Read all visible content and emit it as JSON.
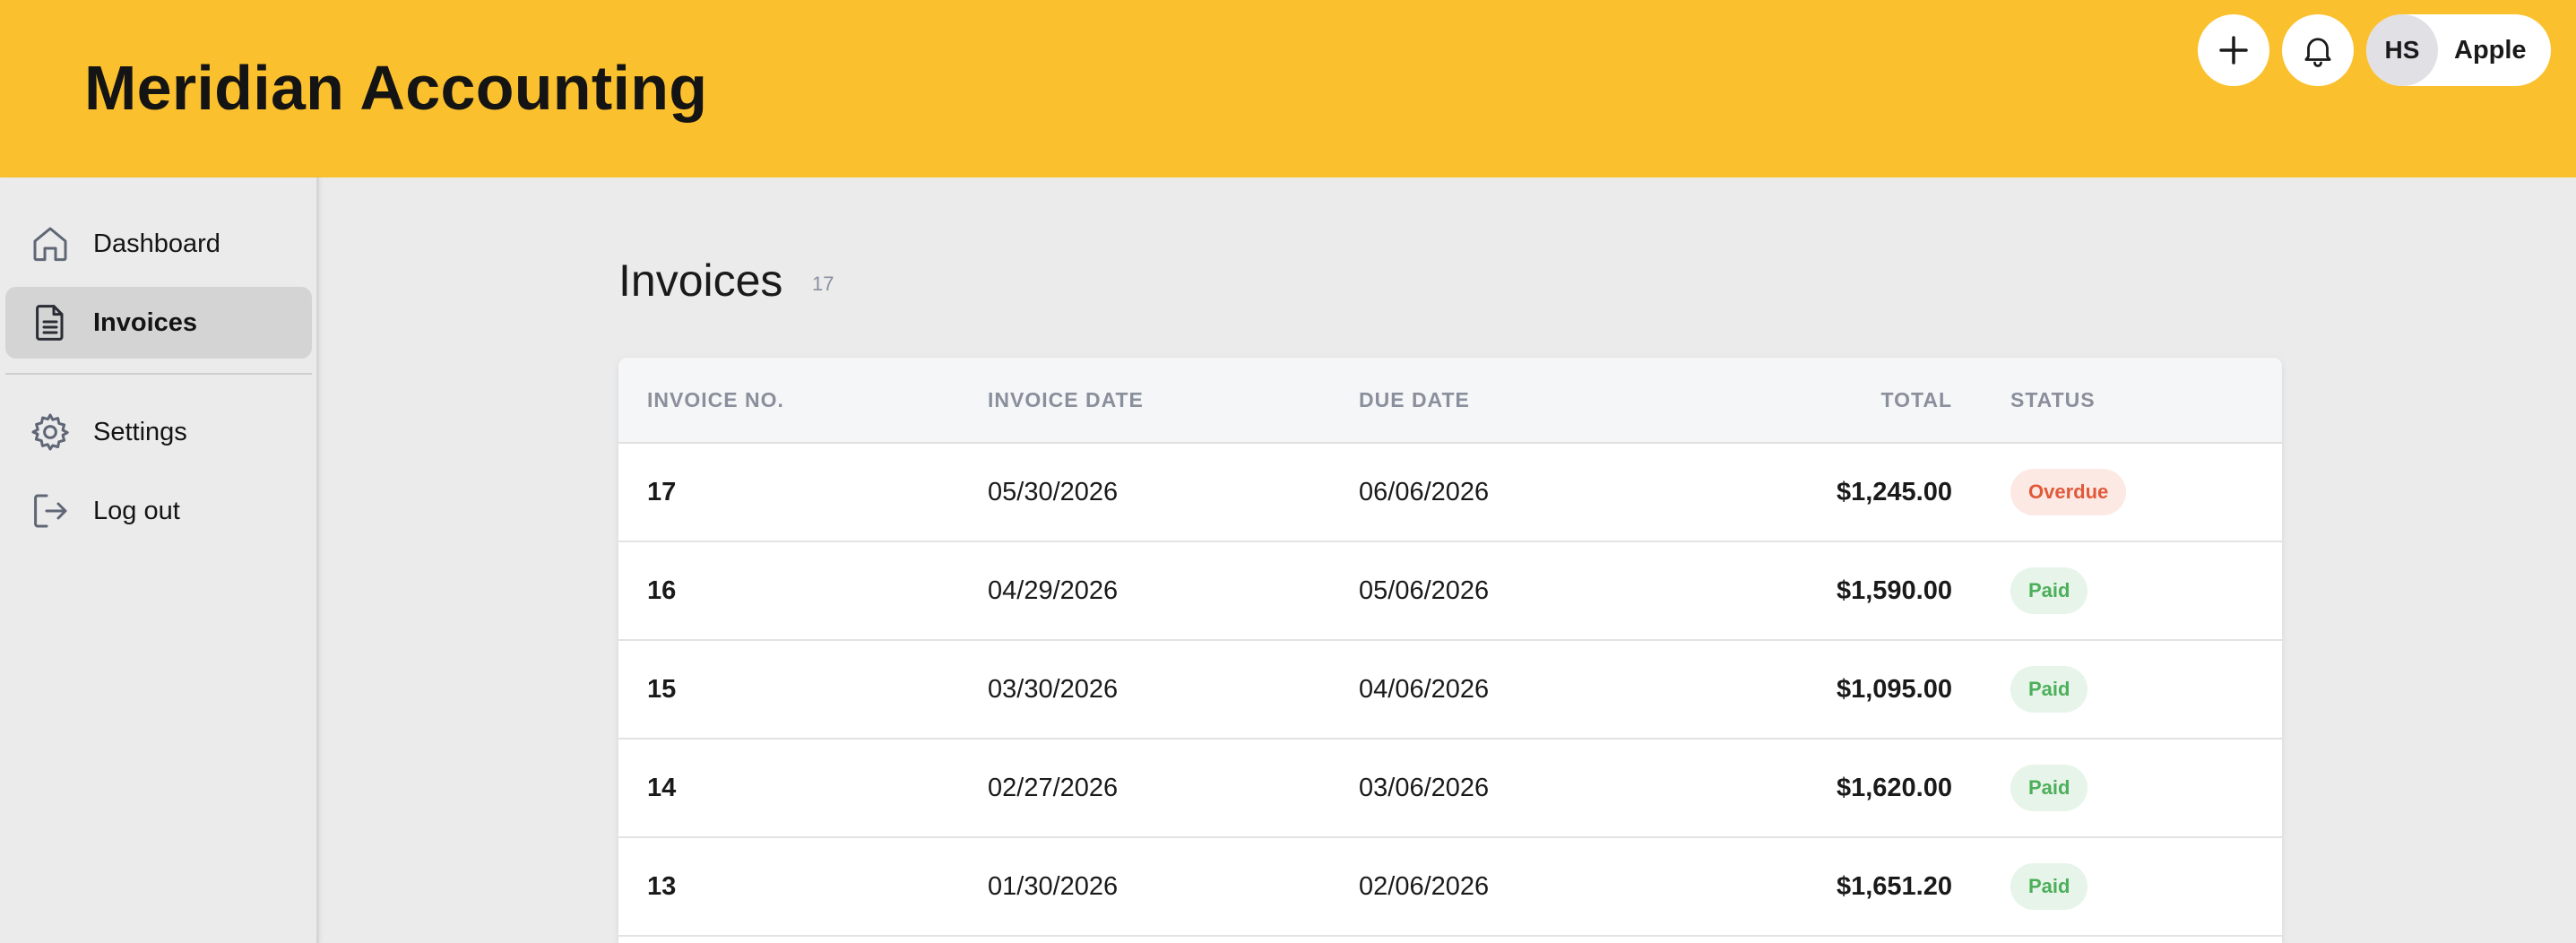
{
  "header": {
    "app_title": "Meridian Accounting",
    "user_initials": "HS",
    "user_name": "Apple"
  },
  "sidebar": {
    "items": [
      {
        "label": "Dashboard",
        "icon": "home-icon"
      },
      {
        "label": "Invoices",
        "icon": "document-icon",
        "active": true
      },
      {
        "label": "Settings",
        "icon": "gear-icon"
      },
      {
        "label": "Log out",
        "icon": "logout-icon"
      }
    ]
  },
  "main": {
    "title": "Invoices",
    "count": "17",
    "columns": [
      "INVOICE NO.",
      "INVOICE DATE",
      "DUE DATE",
      "TOTAL",
      "STATUS"
    ],
    "rows": [
      {
        "no": "17",
        "invoice_date": "05/30/2026",
        "due_date": "06/06/2026",
        "total": "$1,245.00",
        "status": "Overdue"
      },
      {
        "no": "16",
        "invoice_date": "04/29/2026",
        "due_date": "05/06/2026",
        "total": "$1,590.00",
        "status": "Paid"
      },
      {
        "no": "15",
        "invoice_date": "03/30/2026",
        "due_date": "04/06/2026",
        "total": "$1,095.00",
        "status": "Paid"
      },
      {
        "no": "14",
        "invoice_date": "02/27/2026",
        "due_date": "03/06/2026",
        "total": "$1,620.00",
        "status": "Paid"
      },
      {
        "no": "13",
        "invoice_date": "01/30/2026",
        "due_date": "02/06/2026",
        "total": "$1,651.20",
        "status": "Paid"
      }
    ]
  },
  "colors": {
    "header_bg": "#fbc02d",
    "overdue": "#e05a3a",
    "paid": "#4caf5a"
  }
}
